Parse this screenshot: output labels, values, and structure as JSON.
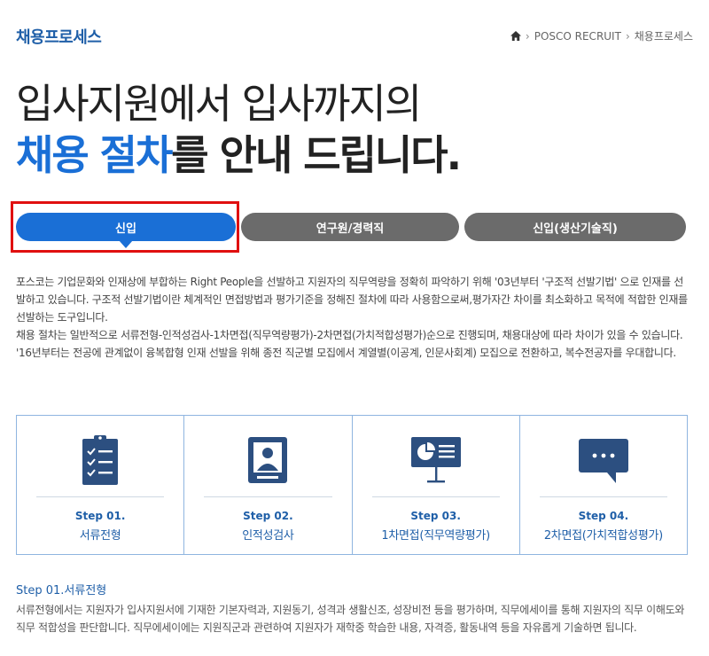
{
  "header": {
    "title": "채용프로세스",
    "breadcrumb": [
      {
        "label": "POSCO RECRUIT"
      },
      {
        "label": "채용프로세스"
      }
    ],
    "separator": "›"
  },
  "hero": {
    "line1": "입사지원에서 입사까지의",
    "line2_accent": "채용 절차",
    "line2_rest": "를 안내 드립니다."
  },
  "tabs": [
    {
      "label": "신입",
      "active": true
    },
    {
      "label": "연구원/경력직",
      "active": false
    },
    {
      "label": "신입(생산기술직)",
      "active": false
    }
  ],
  "intro": {
    "p1": "포스코는 기업문화와 인재상에 부합하는 Right People을 선발하고 지원자의 직무역량을 정확히 파악하기 위해 '03년부터 '구조적 선발기법' 으로 인재를 선발하고 있습니다. 구조적 선발기법이란 체계적인 면접방법과 평가기준을 정해진 절차에 따라 사용함으로써,평가자간 차이를 최소화하고 목적에 적합한 인재를 선발하는 도구입니다.",
    "p2": "채용 절차는 일반적으로 서류전형-인적성검사-1차면접(직무역량평가)-2차면접(가치적합성평가)순으로 진행되며, 채용대상에 따라 차이가 있을 수 있습니다.",
    "p3": "'16년부터는 전공에 관계없이 융복합형 인재 선발을 위해 종전 직군별 모집에서 계열별(이공계, 인문사회계) 모집으로 전환하고, 복수전공자를 우대합니다."
  },
  "steps": [
    {
      "num": "Step 01.",
      "name": "서류전형",
      "icon": "document-checklist-icon"
    },
    {
      "num": "Step 02.",
      "name": "인적성검사",
      "icon": "id-card-icon"
    },
    {
      "num": "Step 03.",
      "name": "1차면접(직무역량평가)",
      "icon": "presentation-board-icon"
    },
    {
      "num": "Step 04.",
      "name": "2차면접(가치적합성평가)",
      "icon": "speech-bubble-icon"
    }
  ],
  "detail": {
    "title": "Step 01.서류전형",
    "body": "서류전형에서는 지원자가 입사지원서에 기재한 기본자력과, 지원동기, 성격과 생활신조, 성장비전 등을 평가하며, 직무에세이를 통해 지원자의 직무 이해도와 직무 적합성을 판단합니다. 직무에세이에는 지원직군과 관련하여 지원자가 재학중 학습한 내용, 자격증, 활동내역 등을 자유롭게 기술하면 됩니다."
  },
  "colors": {
    "brand_blue": "#1a6fd6",
    "title_blue": "#1f5fa8",
    "tab_inactive": "#6b6b6b",
    "highlight_red": "#e01010",
    "icon_navy": "#2c4f80"
  }
}
